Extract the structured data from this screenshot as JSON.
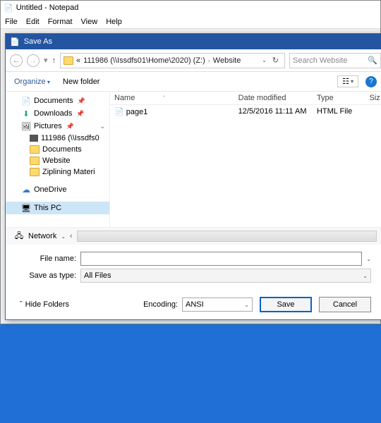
{
  "notepad": {
    "title": "Untitled - Notepad",
    "menu": [
      "File",
      "Edit",
      "Format",
      "View",
      "Help"
    ]
  },
  "dialog": {
    "title": "Save As",
    "path": {
      "prefix": "«",
      "seg1": "111986 (\\\\Issdfs01\\Home\\2020) (Z:)",
      "seg2": "Website"
    },
    "search_placeholder": "Search Website",
    "toolbar": {
      "organize": "Organize",
      "newfolder": "New folder"
    },
    "tree": [
      {
        "icon": "doc",
        "label": "Documents",
        "pin": true
      },
      {
        "icon": "dl",
        "label": "Downloads",
        "pin": true
      },
      {
        "icon": "pic",
        "label": "Pictures",
        "pin": true,
        "expand": true
      },
      {
        "icon": "net",
        "label": "111986 (\\\\Issdfs0",
        "depth": 1
      },
      {
        "icon": "fld",
        "label": "Documents",
        "depth": 1
      },
      {
        "icon": "fld",
        "label": "Website",
        "depth": 1
      },
      {
        "icon": "fld",
        "label": "Ziplining Materi",
        "depth": 1
      },
      {
        "icon": "od",
        "label": "OneDrive",
        "spaced": true
      },
      {
        "icon": "pc",
        "label": "This PC",
        "sel": true,
        "spaced": true
      }
    ],
    "network_label": "Network",
    "columns": {
      "name": "Name",
      "date": "Date modified",
      "type": "Type",
      "size": "Siz"
    },
    "rows": [
      {
        "name": "page1",
        "date": "12/5/2016 11:11 AM",
        "type": "HTML File",
        "size": ""
      }
    ],
    "file_name_label": "File name:",
    "file_name_value": "",
    "save_type_label": "Save as type:",
    "save_type_value": "All Files",
    "hide_folders": "Hide Folders",
    "encoding_label": "Encoding:",
    "encoding_value": "ANSI",
    "save": "Save",
    "cancel": "Cancel"
  }
}
